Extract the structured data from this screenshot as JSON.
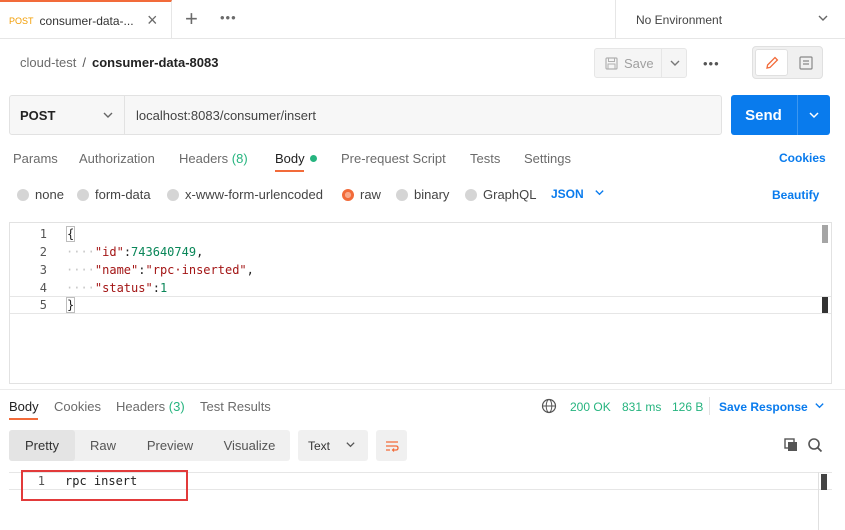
{
  "tab": {
    "method": "POST",
    "title": "consumer-data-...",
    "close": "×"
  },
  "tabbar": {
    "new": "+",
    "more": "ooo"
  },
  "environment": {
    "label": "No Environment"
  },
  "breadcrumb": {
    "collection": "cloud-test",
    "separator": "/",
    "request": "consumer-data-8083"
  },
  "toolbar": {
    "save_label": "Save",
    "more": "ooo"
  },
  "request": {
    "method": "POST",
    "url": "localhost:8083/consumer/insert",
    "send_label": "Send"
  },
  "request_tabs": [
    {
      "label": "Params"
    },
    {
      "label": "Authorization"
    },
    {
      "label": "Headers",
      "count": "(8)"
    },
    {
      "label": "Body"
    },
    {
      "label": "Pre-request Script"
    },
    {
      "label": "Tests"
    },
    {
      "label": "Settings"
    }
  ],
  "cookies_label": "Cookies",
  "body_types": [
    {
      "label": "none"
    },
    {
      "label": "form-data"
    },
    {
      "label": "x-www-form-urlencoded"
    },
    {
      "label": "raw"
    },
    {
      "label": "binary"
    },
    {
      "label": "GraphQL"
    }
  ],
  "body_format": "JSON",
  "beautify_label": "Beautify",
  "editor": {
    "lines": [
      {
        "num": "1",
        "open": "{"
      },
      {
        "num": "2",
        "indent": "····",
        "key": "\"id\"",
        "colon": ":",
        "value": "743640749",
        "comma": ","
      },
      {
        "num": "3",
        "indent": "····",
        "key": "\"name\"",
        "colon": ":",
        "value": "\"rpc·inserted\"",
        "comma": ","
      },
      {
        "num": "4",
        "indent": "····",
        "key": "\"status\"",
        "colon": ":",
        "value": "1",
        "comma": ""
      },
      {
        "num": "5",
        "close": "}"
      }
    ]
  },
  "response_tabs": [
    {
      "label": "Body"
    },
    {
      "label": "Cookies"
    },
    {
      "label": "Headers",
      "count": "(3)"
    },
    {
      "label": "Test Results"
    }
  ],
  "response_meta": {
    "status": "200 OK",
    "time": "831 ms",
    "size": "126 B",
    "save_label": "Save Response"
  },
  "response_views": [
    "Pretty",
    "Raw",
    "Preview",
    "Visualize"
  ],
  "response_format": "Text",
  "response_body": {
    "num": "1",
    "text": "rpc insert"
  },
  "colors": {
    "accent": "#f26b3a",
    "brand_blue": "#097bed",
    "success": "#26b47f",
    "highlight": "#e23a3a"
  }
}
